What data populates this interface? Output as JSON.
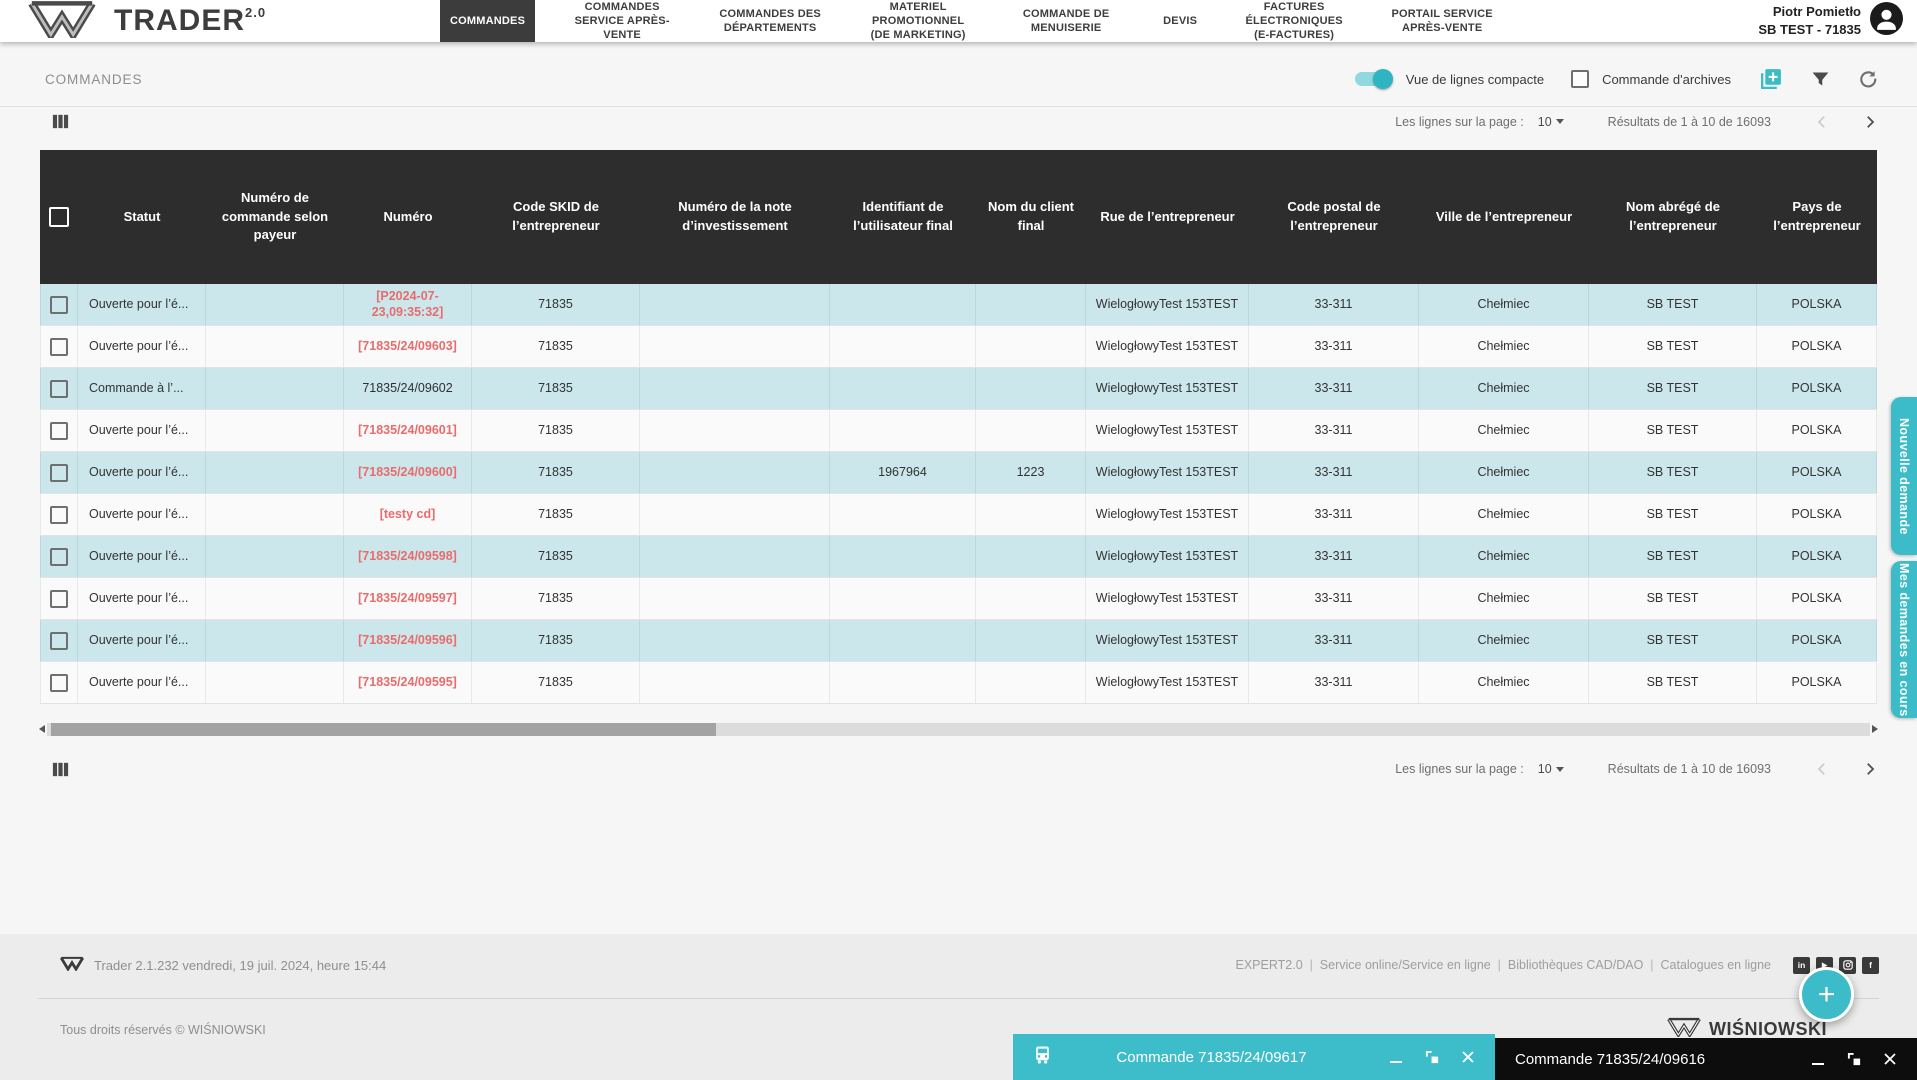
{
  "colors": {
    "accent": "#3bbcc8",
    "table_header": "#2d2d2d",
    "row_alt": "#cbe7ec",
    "link_red": "#e86c6c"
  },
  "brand": {
    "name": "TRADER",
    "version": "2.0"
  },
  "nav": {
    "items": [
      {
        "label": "COMMANDES",
        "active": true
      },
      {
        "label": "COMMANDES SERVICE APRÈS-VENTE"
      },
      {
        "label": "COMMANDES DES DÉPARTEMENTS"
      },
      {
        "label": "MATERIEL PROMOTIONNEL (DE MARKETING)"
      },
      {
        "label": "COMMANDE DE MENUISERIE"
      },
      {
        "label": "DEVIS"
      },
      {
        "label": "FACTURES ÉLECTRONIQUES (E-FACTURES)"
      },
      {
        "label": "PORTAIL SERVICE APRÈS-VENTE"
      }
    ]
  },
  "user": {
    "name": "Piotr Pomietło",
    "account": "SB TEST - 71835"
  },
  "toolbar": {
    "breadcrumb": "COMMANDES",
    "compact_view_label": "Vue de lignes compacte",
    "compact_view_on": true,
    "archive_label": "Commande d'archives",
    "archive_checked": false
  },
  "pagination": {
    "rows_per_page_label": "Les lignes sur la page :",
    "rows_per_page_value": "10",
    "results_label": "Résultats de 1 à 10 de 16093"
  },
  "table": {
    "columns": [
      "Statut",
      "Numéro de commande selon payeur",
      "Numéro",
      "Code SKID de l’entrepreneur",
      "Numéro de la note d’investissement",
      "Identifiant de l’utilisateur final",
      "Nom du client final",
      "Rue de l’entrepreneur",
      "Code postal de l’entrepreneur",
      "Ville de l’entrepreneur",
      "Nom abrégé de l’entrepreneur",
      "Pays de l’entrepreneur"
    ],
    "rows": [
      {
        "status": "Ouverte pour l’é...",
        "payer_no": "",
        "number": "[P2024-07-23,09:35:32]",
        "red": true,
        "skid": "71835",
        "invest_note": "",
        "end_user_id": "",
        "client_no": "",
        "street": "WielogłowyTest 153TEST",
        "postal": "33-311",
        "city": "Chełmiec",
        "short_name": "SB TEST",
        "country": "POLSKA"
      },
      {
        "status": "Ouverte pour l’é...",
        "payer_no": "",
        "number": "[71835/24/09603]",
        "red": true,
        "skid": "71835",
        "invest_note": "",
        "end_user_id": "",
        "client_no": "",
        "street": "WielogłowyTest 153TEST",
        "postal": "33-311",
        "city": "Chełmiec",
        "short_name": "SB TEST",
        "country": "POLSKA"
      },
      {
        "status": "Commande à l’...",
        "payer_no": "",
        "number": "71835/24/09602",
        "red": false,
        "skid": "71835",
        "invest_note": "",
        "end_user_id": "",
        "client_no": "",
        "street": "WielogłowyTest 153TEST",
        "postal": "33-311",
        "city": "Chełmiec",
        "short_name": "SB TEST",
        "country": "POLSKA"
      },
      {
        "status": "Ouverte pour l’é...",
        "payer_no": "",
        "number": "[71835/24/09601]",
        "red": true,
        "skid": "71835",
        "invest_note": "",
        "end_user_id": "",
        "client_no": "",
        "street": "WielogłowyTest 153TEST",
        "postal": "33-311",
        "city": "Chełmiec",
        "short_name": "SB TEST",
        "country": "POLSKA"
      },
      {
        "status": "Ouverte pour l’é...",
        "payer_no": "",
        "number": "[71835/24/09600]",
        "red": true,
        "skid": "71835",
        "invest_note": "",
        "end_user_id": "1967964",
        "client_no": "1223",
        "street": "WielogłowyTest 153TEST",
        "postal": "33-311",
        "city": "Chełmiec",
        "short_name": "SB TEST",
        "country": "POLSKA"
      },
      {
        "status": "Ouverte pour l’é...",
        "payer_no": "",
        "number": "[testy cd]",
        "red": true,
        "skid": "71835",
        "invest_note": "",
        "end_user_id": "",
        "client_no": "",
        "street": "WielogłowyTest 153TEST",
        "postal": "33-311",
        "city": "Chełmiec",
        "short_name": "SB TEST",
        "country": "POLSKA"
      },
      {
        "status": "Ouverte pour l’é...",
        "payer_no": "",
        "number": "[71835/24/09598]",
        "red": true,
        "skid": "71835",
        "invest_note": "",
        "end_user_id": "",
        "client_no": "",
        "street": "WielogłowyTest 153TEST",
        "postal": "33-311",
        "city": "Chełmiec",
        "short_name": "SB TEST",
        "country": "POLSKA"
      },
      {
        "status": "Ouverte pour l’é...",
        "payer_no": "",
        "number": "[71835/24/09597]",
        "red": true,
        "skid": "71835",
        "invest_note": "",
        "end_user_id": "",
        "client_no": "",
        "street": "WielogłowyTest 153TEST",
        "postal": "33-311",
        "city": "Chełmiec",
        "short_name": "SB TEST",
        "country": "POLSKA"
      },
      {
        "status": "Ouverte pour l’é...",
        "payer_no": "",
        "number": "[71835/24/09596]",
        "red": true,
        "skid": "71835",
        "invest_note": "",
        "end_user_id": "",
        "client_no": "",
        "street": "WielogłowyTest 153TEST",
        "postal": "33-311",
        "city": "Chełmiec",
        "short_name": "SB TEST",
        "country": "POLSKA"
      },
      {
        "status": "Ouverte pour l’é...",
        "payer_no": "",
        "number": "[71835/24/09595]",
        "red": true,
        "skid": "71835",
        "invest_note": "",
        "end_user_id": "",
        "client_no": "",
        "street": "WielogłowyTest 153TEST",
        "postal": "33-311",
        "city": "Chełmiec",
        "short_name": "SB TEST",
        "country": "POLSKA"
      }
    ]
  },
  "side_tabs": [
    {
      "label": "Nouvelle demande"
    },
    {
      "label": "Mes demandes en cours"
    }
  ],
  "footer": {
    "version_line": "Trader 2.1.232 vendredi, 19 juil. 2024, heure 15:44",
    "links": [
      "EXPERT2.0",
      "Service online/Service en ligne",
      "Bibliothèques CAD/DAO",
      "Catalogues en ligne"
    ],
    "social": [
      "linkedin",
      "youtube",
      "instagram",
      "facebook"
    ],
    "copyright": "Tous droits réservés © WIŚNIOWSKI",
    "brand": "WIŚNIOWSKI"
  },
  "windows": [
    {
      "title": "Commande 71835/24/09617"
    },
    {
      "title": "Commande 71835/24/09616"
    }
  ],
  "fab": {
    "label": "+"
  }
}
